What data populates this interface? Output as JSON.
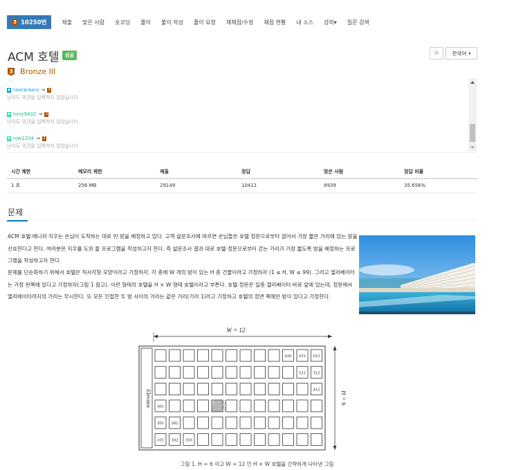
{
  "nav": {
    "brand": "10250번",
    "items": [
      "제출",
      "맞은 사람",
      "숏코딩",
      "풀이",
      "풀이 작성",
      "풀이 요청",
      "재채점/수정",
      "채점 현황",
      "내 소스",
      "강의▾",
      "질문 검색"
    ]
  },
  "problem": {
    "title": "ACM 호텔",
    "status_badge": "성공",
    "star": "☆",
    "language": "한국어",
    "tier_level": "3",
    "tier": "Bronze III"
  },
  "votes": [
    {
      "user": "raararaara",
      "arrow": "→",
      "hint": "난이도 의견을 입력하지 않았습니다",
      "color": "#009ee5"
    },
    {
      "user": "tony9402",
      "arrow": "→",
      "hint": "난이도 의견을 입력하지 않았습니다",
      "color": "#27e2a4"
    },
    {
      "user": "njw1204",
      "arrow": "→",
      "hint": "난이도 의견을 입력하지 않았습니다",
      "color": "#27e2a4"
    }
  ],
  "stats": {
    "headers": [
      "시간 제한",
      "메모리 제한",
      "제출",
      "정답",
      "맞은 사람",
      "정답 비율"
    ],
    "values": [
      "1 초",
      "256 MB",
      "29149",
      "10411",
      "8939",
      "35.656%"
    ]
  },
  "section": {
    "title": "문제"
  },
  "body": {
    "p1": "ACM 호텔 매니저 지우는 손님이 도착하는 대로 빈 방을 배정하고 있다. 고객 설문조사에 따르면 손님들은 호텔 정문으로부터 걸어서 가장 짧은 거리에 있는 방을 선호한다고 한다. 여러분은 지우를 도와 줄 프로그램을 작성하고자 한다. 즉 설문조사 결과 대로 호텔 정문으로부터 걷는 거리가 가장 짧도록 방을 배정하는 프로그램을 작성하고자 한다.",
    "p2": "문제를 단순화하기 위해서 호텔은 직사각형 모양이라고 가정하자. 각 층에 W 개의 방이 있는 H 층 건물이라고 가정하자 (1 ≤ H, W ≤ 99). 그리고 엘리베이터는 가장 왼쪽에 있다고 가정하자(그림 1 참고). 이런 형태의 호텔을 H × W 형태 호텔이라고 부른다. 호텔 정문은 일층 엘리베이터 바로 앞에 있는데, 정문에서 엘리베이터까지의 거리는 무시한다. 또 모든 인접한 두 방 사이의 거리는 같은 거리(거리 1)라고 가정하고 호텔의 정면 쪽에만 방이 있다고 가정한다."
  },
  "figure": {
    "w_label": "W = 12",
    "h_label": "H = 6",
    "elevator": "Elevator",
    "rooms": {
      "610": "610",
      "611": "611",
      "612": "612",
      "511": "511",
      "512": "512",
      "412": "412",
      "301": "301",
      "201": "201",
      "202": "202",
      "101": "101",
      "102": "102",
      "103": "103"
    },
    "caption": "그림 1. H = 6 이고 W = 12 인 H × W 호텔을 간략하게 나타낸 그림"
  }
}
